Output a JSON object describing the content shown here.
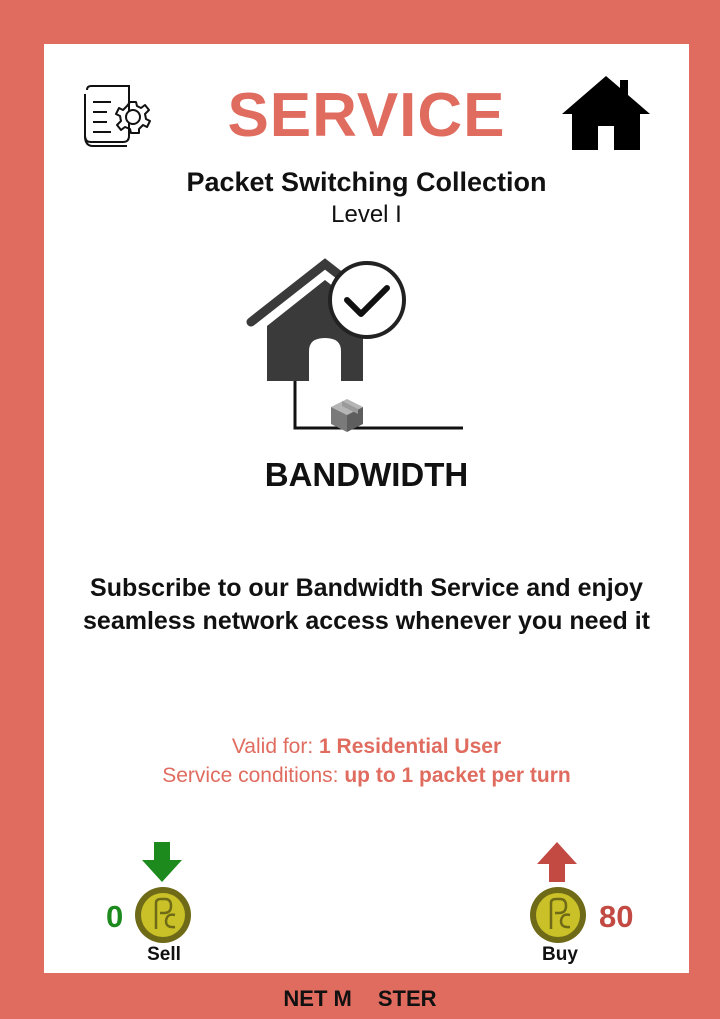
{
  "card": {
    "title": "SERVICE",
    "collection": "Packet Switching Collection",
    "level": "Level I",
    "name": "BANDWIDTH",
    "description": "Subscribe to our Bandwidth Service and enjoy seamless network access whenever you need it",
    "valid_label": "Valid for:",
    "valid_value": "1 Residential User",
    "conditions_label": "Service conditions:",
    "conditions_value": "up to 1 packet per turn"
  },
  "sell": {
    "price": "0",
    "label": "Sell",
    "arrow": "down-arrow-icon"
  },
  "buy": {
    "price": "80",
    "label": "Buy",
    "arrow": "up-arrow-icon"
  },
  "footer": {
    "brand_left": "NET M",
    "brand_right": "STER"
  },
  "icons": {
    "top_left": "settings-document-icon",
    "top_right": "home-icon",
    "illustration": "house-check-icon",
    "coin": "coin-icon"
  },
  "colors": {
    "border": "#e06c5f",
    "title": "#e06c5f",
    "sell": "#1c8a1c",
    "buy": "#c24a42",
    "coin": "#c9c127"
  }
}
